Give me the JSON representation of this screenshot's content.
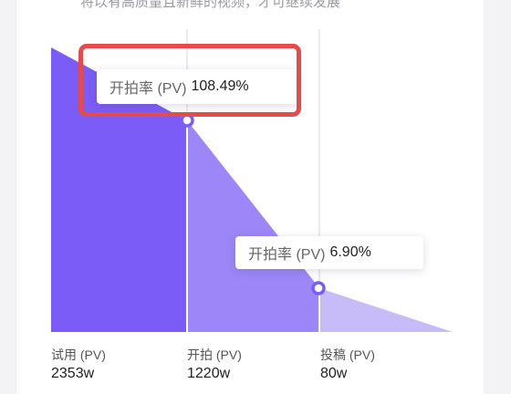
{
  "header": {
    "top_text": "将以有高质量且新鲜的视频，才可继续发展"
  },
  "colors": {
    "stage1": "#7b5cf7",
    "stage2": "#9c86f8",
    "stage3": "#c8bcf8",
    "divider": "#e2e2e8",
    "highlight": "#e84a4a"
  },
  "tooltips": [
    {
      "label": "开拍率 (PV)",
      "value": "108.49%"
    },
    {
      "label": "开拍率 (PV)",
      "value": "6.90%"
    }
  ],
  "stages": [
    {
      "label": "试用 (PV)",
      "value": "2353w"
    },
    {
      "label": "开拍 (PV)",
      "value": "1220w"
    },
    {
      "label": "投稿 (PV)",
      "value": "80w"
    }
  ]
}
